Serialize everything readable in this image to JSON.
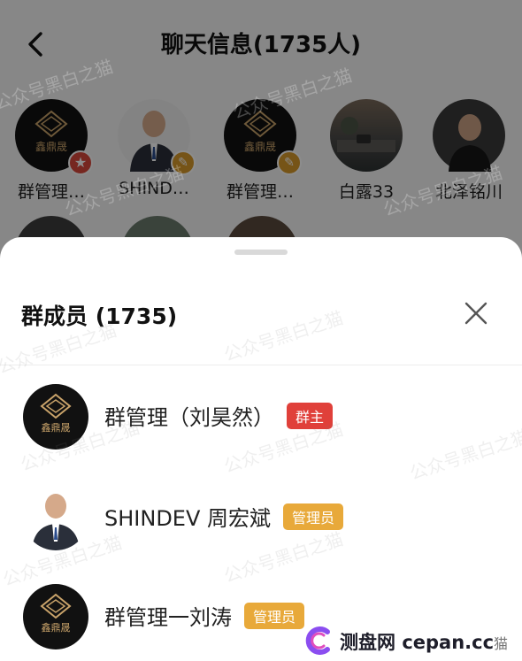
{
  "header": {
    "title": "聊天信息(1735人)"
  },
  "avatars": [
    {
      "name": "群管理…",
      "badge": "owner"
    },
    {
      "name": "SHIND…",
      "badge": "admin"
    },
    {
      "name": "群管理…",
      "badge": "admin"
    },
    {
      "name": "白露33",
      "badge": ""
    },
    {
      "name": "北泽铭川",
      "badge": ""
    }
  ],
  "logo_text": "鑫鼎晟",
  "sheet": {
    "title": "群成员 (1735)",
    "members": [
      {
        "name": "群管理（刘昊然）",
        "tag": "群主",
        "tag_type": "owner"
      },
      {
        "name": "SHINDEV 周宏斌",
        "tag": "管理员",
        "tag_type": "admin"
      },
      {
        "name": "群管理一刘涛",
        "tag": "管理员",
        "tag_type": "admin"
      }
    ]
  },
  "watermark": "公众号黑白之猫",
  "footer": {
    "brand": "测盘网",
    "domain": "cepan.cc",
    "suffix": "猫"
  },
  "colors": {
    "owner_tag": "#e0403a",
    "admin_tag": "#e8a93a",
    "brand_bg": "#111111",
    "logo_gold": "#c9a36a"
  }
}
